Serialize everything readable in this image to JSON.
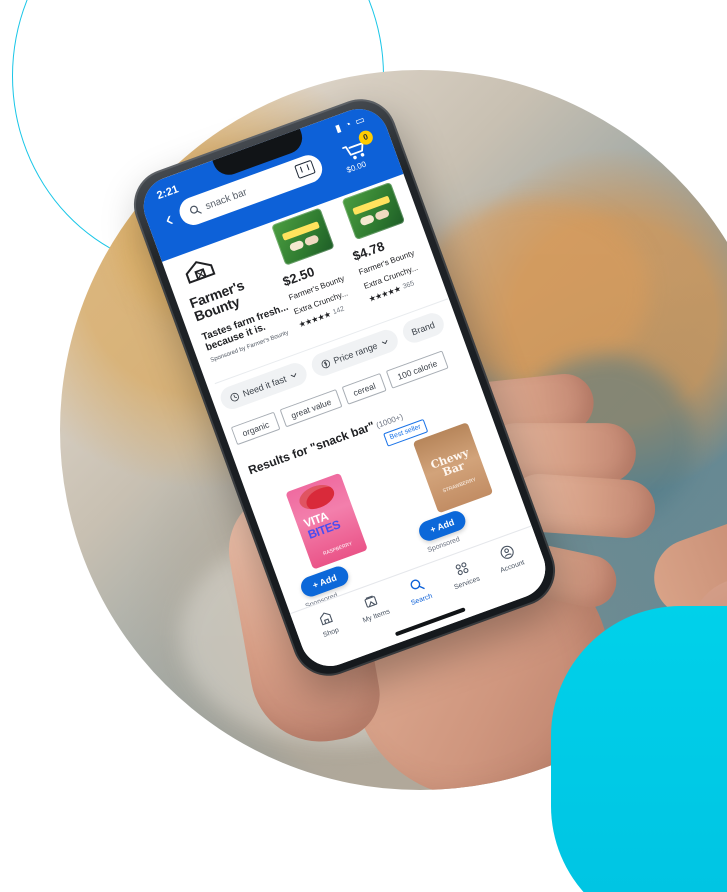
{
  "phone_ui": {
    "status_bar": {
      "time": "2:21"
    },
    "header": {
      "search_text": "snack bar",
      "cart_count": "0",
      "cart_total": "$0.00"
    },
    "sponsored_brand": {
      "name_line1": "Farmer's",
      "name_line2": "Bounty",
      "tagline_line1": "Tastes farm fresh...",
      "tagline_line2": "because it is.",
      "sponsored_by": "Sponsored by Farmer's Bounty"
    },
    "sponsored_products": [
      {
        "price": "$2.50",
        "title_line1": "Farmer's Bounty",
        "title_line2": "Extra Crunchy...",
        "rating_count": "142"
      },
      {
        "price": "$4.78",
        "title_line1": "Farmer's Bounty",
        "title_line2": "Extra Crunchy...",
        "rating_count": "365"
      }
    ],
    "filters": [
      "Need it fast",
      "Price range",
      "Brand"
    ],
    "tags": [
      "organic",
      "great value",
      "cereal",
      "100 calorie"
    ],
    "results": {
      "title_prefix": "Results for ",
      "query": "\"snack bar\"",
      "count": "(1000+)"
    },
    "cards": [
      {
        "brand_line1": "VITA",
        "brand_line2": "BITES",
        "flavor": "RASPBERRY",
        "add_label": "+ Add",
        "sponsored_label": "Sponsored"
      },
      {
        "badge": "Best seller",
        "brand_line1": "Chewy Bar",
        "flavor": "STRAWBERRY",
        "add_label": "+ Add",
        "sponsored_label": "Sponsored"
      }
    ],
    "bottom_nav": [
      {
        "label": "Shop",
        "icon": "shop-icon"
      },
      {
        "label": "My Items",
        "icon": "my-items-icon"
      },
      {
        "label": "Search",
        "icon": "search-icon"
      },
      {
        "label": "Services",
        "icon": "services-icon"
      },
      {
        "label": "Account",
        "icon": "account-icon"
      }
    ]
  },
  "colors": {
    "header_blue": "#0d61d8",
    "accent_cyan": "#00c3e2",
    "outline_cyan": "#19c6e7"
  }
}
